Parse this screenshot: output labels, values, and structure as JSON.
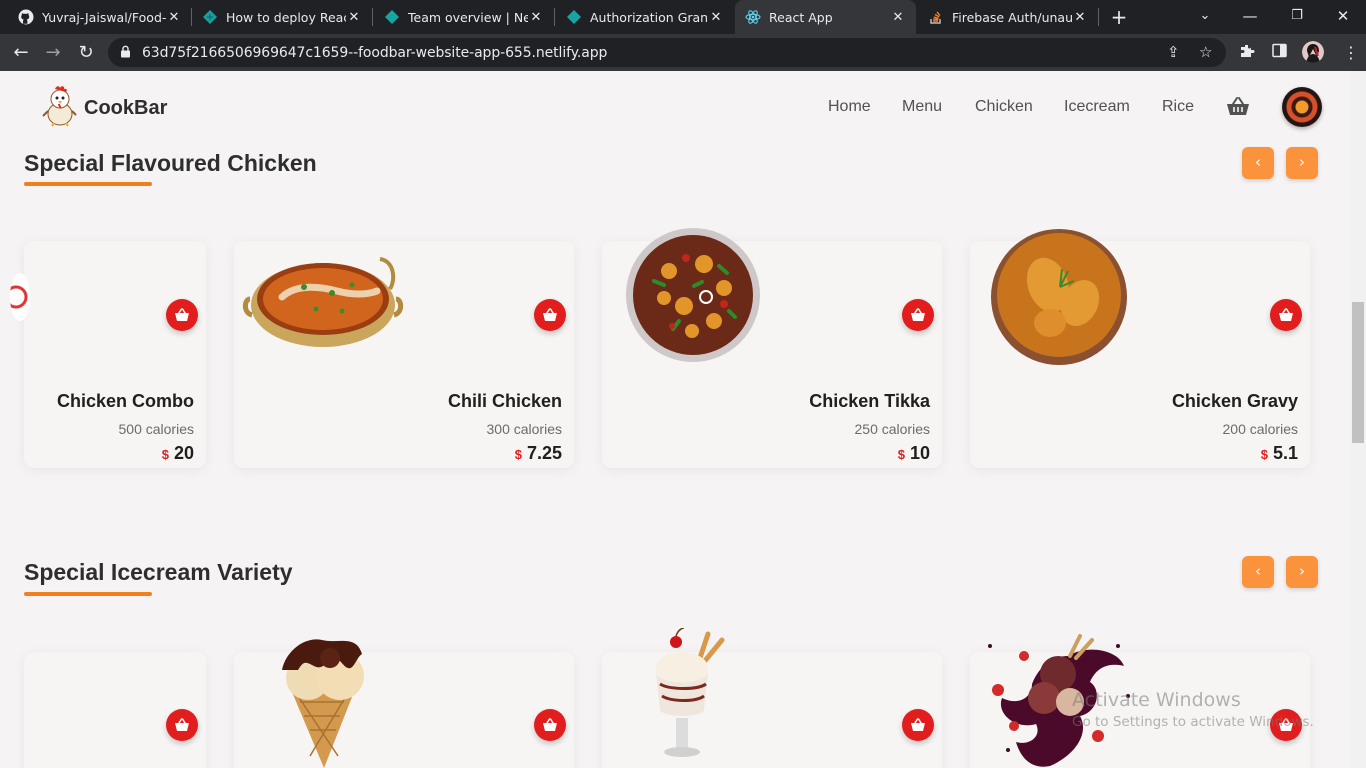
{
  "browser": {
    "tabs": [
      {
        "title": "Yuvraj-Jaiswal/Food-D",
        "icon": "github-icon"
      },
      {
        "title": "How to deploy React A",
        "icon": "netlify-icon"
      },
      {
        "title": "Team overview | Netlif",
        "icon": "netlify-icon"
      },
      {
        "title": "Authorization Granted",
        "icon": "netlify-icon"
      },
      {
        "title": "React App",
        "icon": "react-icon"
      },
      {
        "title": "Firebase Auth/unauth",
        "icon": "stackoverflow-icon"
      }
    ],
    "active_tab": 4,
    "url": "63d75f2166506969647c1659--foodbar-website-app-655.netlify.app"
  },
  "site": {
    "brand": "CookBar",
    "nav": [
      "Home",
      "Menu",
      "Chicken",
      "Icecream",
      "Rice"
    ]
  },
  "sections": [
    {
      "title": "Special Flavoured Chicken",
      "items": [
        {
          "name": "Chicken Combo",
          "calories": "500 calories",
          "currency": "$",
          "price": "20"
        },
        {
          "name": "Chili Chicken",
          "calories": "300 calories",
          "currency": "$",
          "price": "7.25"
        },
        {
          "name": "Chicken Tikka",
          "calories": "250 calories",
          "currency": "$",
          "price": "10"
        },
        {
          "name": "Chicken Gravy",
          "calories": "200 calories",
          "currency": "$",
          "price": "5.1"
        }
      ]
    },
    {
      "title": "Special Icecream Variety",
      "items": []
    }
  ],
  "watermark": {
    "line1": "Activate Windows",
    "line2": "Go to Settings to activate Windows."
  },
  "colors": {
    "accent": "#fb923c",
    "underline": "#f07f1e",
    "add_button": "#e11d1d"
  }
}
